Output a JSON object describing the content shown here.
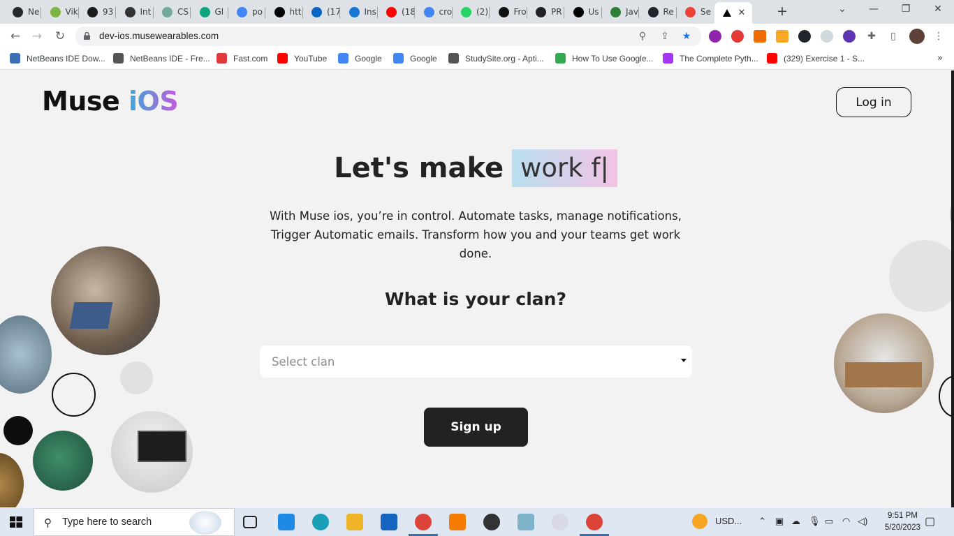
{
  "browser": {
    "tabs": [
      {
        "label": "Ne",
        "icon": "github-icon",
        "color": "#24292f"
      },
      {
        "label": "Vik",
        "icon": "image-icon",
        "color": "#7cb342"
      },
      {
        "label": "93",
        "icon": "cursor-icon",
        "color": "#1b1b1b"
      },
      {
        "label": "Int",
        "icon": "openai-icon",
        "color": "#333"
      },
      {
        "label": "CS",
        "icon": "chatgpt-icon",
        "color": "#74aa9c"
      },
      {
        "label": "Gl",
        "icon": "gatsby-icon",
        "color": "#10a37f"
      },
      {
        "label": "po",
        "icon": "google-icon",
        "color": "#4285f4"
      },
      {
        "label": "htt",
        "icon": "vercel-icon",
        "color": "#000"
      },
      {
        "label": "(17",
        "icon": "linkedin-icon",
        "color": "#0a66c2"
      },
      {
        "label": "Ins",
        "icon": "mui-icon",
        "color": "#1976d2"
      },
      {
        "label": "(18",
        "icon": "youtube-icon",
        "color": "#ff0000"
      },
      {
        "label": "cro",
        "icon": "google-icon",
        "color": "#4285f4"
      },
      {
        "label": "(2)",
        "icon": "whatsapp-icon",
        "color": "#25d366"
      },
      {
        "label": "Fro",
        "icon": "fp-icon",
        "color": "#111"
      },
      {
        "label": "PR",
        "icon": "circle-icon",
        "color": "#222"
      },
      {
        "label": "Us",
        "icon": "medium-icon",
        "color": "#000"
      },
      {
        "label": "Jav",
        "icon": "goggles-icon",
        "color": "#2e7d32"
      },
      {
        "label": "Re",
        "icon": "react-icon",
        "color": "#20232a"
      },
      {
        "label": "Se",
        "icon": "gmail-icon",
        "color": "#ea4335"
      }
    ],
    "active_tab_close": "✕",
    "new_tab": "+",
    "url": "dev-ios.musewearables.com",
    "window_controls": {
      "dropdown": "⌄",
      "minimize": "—",
      "restore": "❐",
      "close": "✕"
    }
  },
  "bookmarks": [
    {
      "label": "NetBeans IDE Dow...",
      "color": "#3f6fb3"
    },
    {
      "label": "NetBeans IDE - Fre...",
      "color": "#555"
    },
    {
      "label": "Fast.com",
      "color": "#e03a3e"
    },
    {
      "label": "YouTube",
      "color": "#ff0000"
    },
    {
      "label": "Google",
      "color": "#4285f4"
    },
    {
      "label": "Google",
      "color": "#4285f4"
    },
    {
      "label": "StudySite.org - Apti...",
      "color": "#555"
    },
    {
      "label": "How To Use Google...",
      "color": "#34a853"
    },
    {
      "label": "The Complete Pyth...",
      "color": "#a435f0"
    },
    {
      "label": "(329) Exercise 1 - S...",
      "color": "#ff0000"
    }
  ],
  "bookmarks_more": "»",
  "page": {
    "logo_main": "Muse",
    "logo_accent": "iOS",
    "login_label": "Log in",
    "headline_static": "Let's make",
    "headline_typed": "work f|",
    "subtitle": "With Muse ios, you’re in control. Automate tasks, manage notifications, Trigger Automatic emails. Transform how you and your teams get work done.",
    "clan_question": "What is your clan?",
    "select_placeholder": "Select clan",
    "signup_label": "Sign up"
  },
  "taskbar": {
    "search_placeholder": "Type here to search",
    "weather": "USD...",
    "time": "9:51 PM",
    "date": "5/20/2023"
  }
}
